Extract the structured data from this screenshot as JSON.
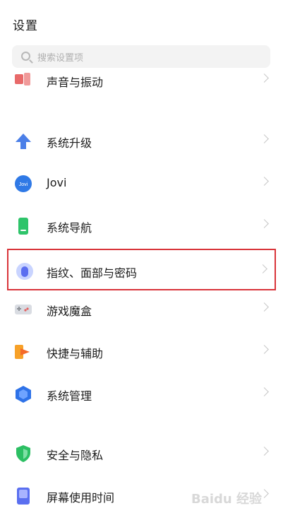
{
  "header": {
    "title": "设置"
  },
  "search": {
    "placeholder": "搜索设置项"
  },
  "items": [
    {
      "label": "声音与振动",
      "icon": "speaker-icon"
    },
    {
      "label": "系统升级",
      "icon": "upgrade-arrow-icon"
    },
    {
      "label": "Jovi",
      "icon": "jovi-icon",
      "icon_text": "Jovi"
    },
    {
      "label": "系统导航",
      "icon": "navigation-phone-icon"
    },
    {
      "label": "指纹、面部与密码",
      "icon": "fingerprint-icon"
    },
    {
      "label": "游戏魔盒",
      "icon": "game-box-icon"
    },
    {
      "label": "快捷与辅助",
      "icon": "shortcut-icon"
    },
    {
      "label": "系统管理",
      "icon": "system-management-icon"
    },
    {
      "label": "安全与隐私",
      "icon": "shield-icon"
    },
    {
      "label": "屏幕使用时间",
      "icon": "screen-time-icon"
    }
  ],
  "watermark": "Baidu 经验",
  "colors": {
    "highlight_border": "#d9343a",
    "accent_blue": "#3d7cf0",
    "green": "#2ec46a",
    "orange": "#f7a128"
  }
}
